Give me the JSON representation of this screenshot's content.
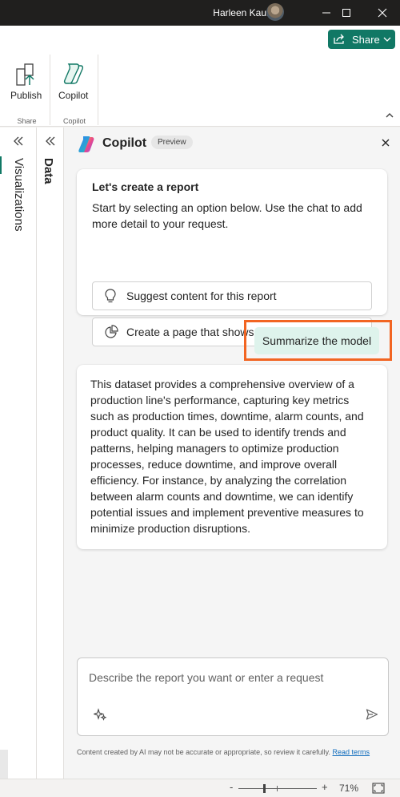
{
  "titlebar": {
    "user_name": "Harleen Kaur",
    "icons": [
      "minimize-icon",
      "maximize-icon",
      "close-icon"
    ]
  },
  "ribbon": {
    "share_label": "Share",
    "groups": [
      {
        "label": "Share",
        "button": "Publish",
        "icon": "publish-icon"
      },
      {
        "label": "Copilot",
        "button": "Copilot",
        "icon": "copilot-icon"
      }
    ]
  },
  "panes": {
    "visualizations": "Visualizations",
    "data": "Data"
  },
  "copilot": {
    "title": "Copilot",
    "badge": "Preview",
    "intro": {
      "title": "Let's create a report",
      "text": "Start by selecting an option below. Use the chat to add more detail to your request.",
      "options": [
        "Suggest content for this report",
        "Create a page that shows..."
      ]
    },
    "user_message": "Summarize the model",
    "answer": "This dataset provides a comprehensive overview of a production line's performance, capturing key metrics such as production times, downtime, alarm counts, and product quality. It can be used to identify trends and patterns, helping managers to optimize production processes, reduce downtime, and improve overall efficiency. For instance, by analyzing the correlation between alarm counts and downtime, we can identify potential issues and implement preventive measures to minimize production disruptions.",
    "input_placeholder": "Describe the report you want or enter a request",
    "disclaimer": "Content created by AI may not be accurate or appropriate, so review it carefully.",
    "disclaimer_link": "Read terms"
  },
  "status": {
    "zoom_minus": "-",
    "zoom_plus": "+",
    "zoom_level": "71%"
  },
  "colors": {
    "accent": "#117865",
    "highlight": "#f26522",
    "user_bubble": "#def3ec"
  }
}
